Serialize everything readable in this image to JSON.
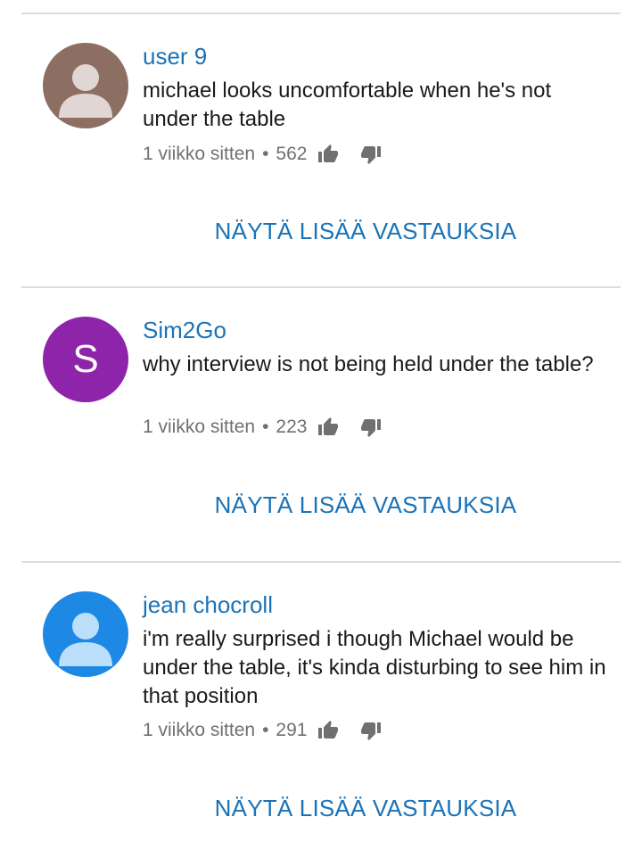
{
  "comments": [
    {
      "author": "user 9",
      "text": "michael looks uncomfortable when he's not under the table",
      "time": "1 viikko sitten",
      "separator": "•",
      "likes": "562",
      "avatar_type": "person-icon",
      "avatar_color": "#8d6e63",
      "more_label": "NÄYTÄ LISÄÄ VASTAUKSIA"
    },
    {
      "author": "Sim2Go",
      "text": "why interview is not being held under the table?",
      "time": "1 viikko sitten",
      "separator": "•",
      "likes": "223",
      "avatar_type": "letter",
      "avatar_letter": "S",
      "avatar_color": "#8e24aa",
      "more_label": "NÄYTÄ LISÄÄ VASTAUKSIA"
    },
    {
      "author": "jean chocroll",
      "text": "i'm really surprised i though Michael would be under the table, it's kinda disturbing to see him in that position",
      "time": "1 viikko sitten",
      "separator": "•",
      "likes": "291",
      "avatar_type": "person-icon",
      "avatar_color": "#1e88e5",
      "more_label": "NÄYTÄ LISÄÄ VASTAUKSIA"
    }
  ],
  "colors": {
    "link_blue": "#1a73b8",
    "meta_gray": "#707070",
    "divider": "#dcdcdc"
  },
  "icons": {
    "like": "thumbs-up-icon",
    "dislike": "thumbs-down-icon"
  }
}
